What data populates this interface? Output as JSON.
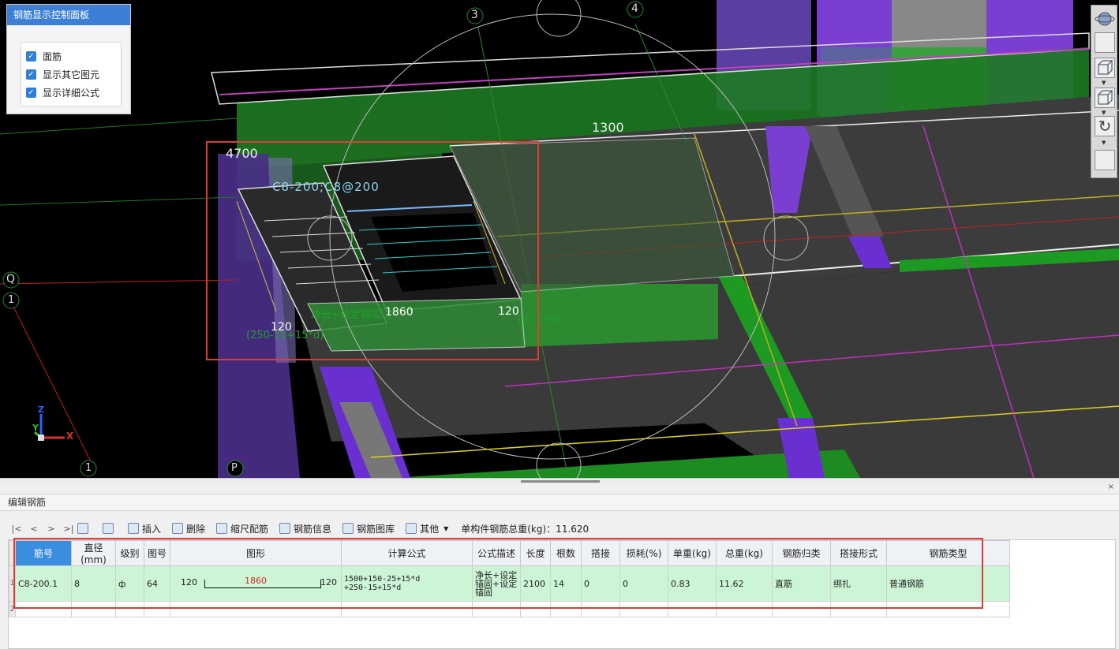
{
  "control_panel": {
    "title": "钢筋显示控制面板",
    "options": [
      {
        "label": "面筋",
        "checked": true
      },
      {
        "label": "显示其它图元",
        "checked": true
      },
      {
        "label": "显示详细公式",
        "checked": true
      }
    ]
  },
  "scene": {
    "axis_labels": {
      "a3": "3",
      "a4": "4",
      "q": "Q",
      "one_left": "1",
      "one_bottom": "1",
      "p": "P"
    },
    "dims": {
      "d4700": "4700",
      "d1300": "1300",
      "d1860": "1860",
      "d120_left": "120",
      "d120_right": "120"
    },
    "rebar_label": "C8-200;C8@200",
    "formula_text": "净长+设定锚固...",
    "formula_partial": "(250-15+15*d)",
    "formula_partial_right": "(+15*d)",
    "coord": {
      "z": "Z",
      "y": "Y",
      "x": "X"
    }
  },
  "editor": {
    "title": "编辑钢筋",
    "close_glyph": "×",
    "nav": [
      "|<",
      "<",
      ">",
      ">|"
    ],
    "tools": [
      "插入",
      "删除",
      "缩尺配筋",
      "钢筋信息",
      "钢筋图库",
      "其他"
    ],
    "total_label": "单构件钢筋总重(kg)：11.620",
    "columns": [
      "筋号",
      "直径(mm)",
      "级别",
      "图号",
      "图形",
      "计算公式",
      "公式描述",
      "长度",
      "根数",
      "搭接",
      "损耗(%)",
      "单重(kg)",
      "总重(kg)",
      "钢筋归类",
      "搭接形式",
      "钢筋类型"
    ],
    "row": {
      "num": "1",
      "bar_no": "C8-200.1",
      "diameter": "8",
      "grade": "ф",
      "fig_no": "64",
      "shape_left": "120",
      "shape_mid": "1860",
      "shape_right": "120",
      "formula_1": "1500+150-25+15*d",
      "formula_2": "+250-15+15*d",
      "desc_1": "净长+设定",
      "desc_2": "锚固+设定",
      "desc_3": "锚固",
      "length": "2100",
      "count": "14",
      "lap": "0",
      "loss": "0",
      "unit_wt": "0.83",
      "total_wt": "11.62",
      "category": "直筋",
      "lap_type": "绑扎",
      "bar_type": "普通钢筋"
    },
    "row2_num": "2"
  }
}
